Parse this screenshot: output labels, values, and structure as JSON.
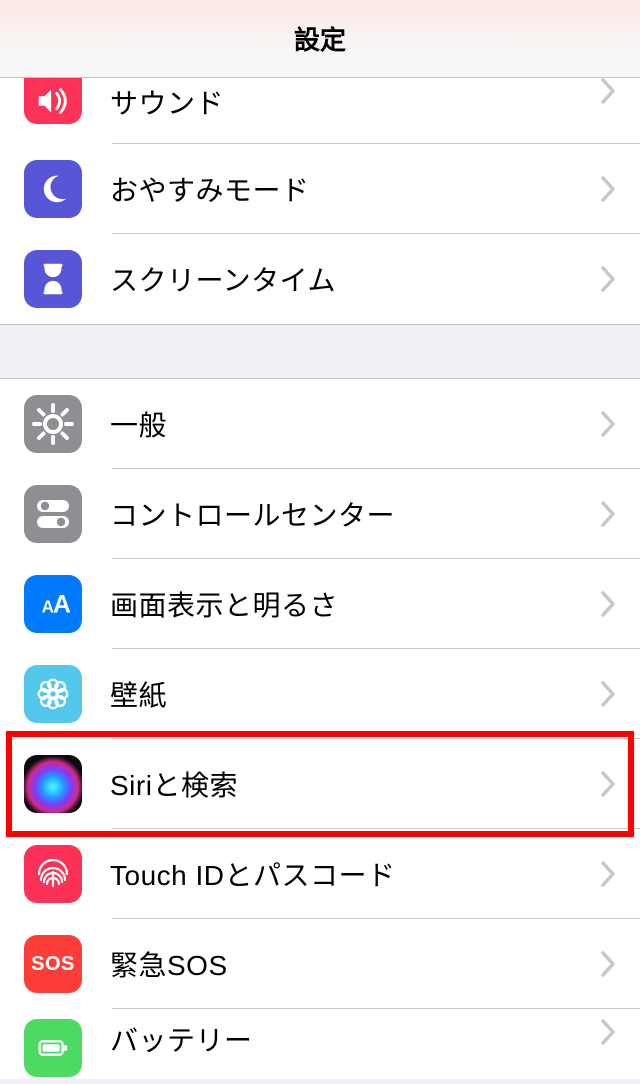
{
  "header": {
    "title": "設定"
  },
  "sections": {
    "g1": [
      {
        "key": "sounds",
        "label": "サウンド"
      },
      {
        "key": "dnd",
        "label": "おやすみモード"
      },
      {
        "key": "screentime",
        "label": "スクリーンタイム"
      }
    ],
    "g2": [
      {
        "key": "general",
        "label": "一般"
      },
      {
        "key": "controlcenter",
        "label": "コントロールセンター"
      },
      {
        "key": "display",
        "label": "画面表示と明るさ"
      },
      {
        "key": "wallpaper",
        "label": "壁紙"
      },
      {
        "key": "siri",
        "label": "Siriと検索",
        "highlighted": true
      },
      {
        "key": "touchid",
        "label": "Touch IDとパスコード"
      },
      {
        "key": "sos",
        "label": "緊急SOS",
        "sos_text": "SOS"
      },
      {
        "key": "battery",
        "label": "バッテリー"
      }
    ]
  },
  "colors": {
    "highlight": "#ff0000",
    "chevron": "#c7c7cc"
  }
}
